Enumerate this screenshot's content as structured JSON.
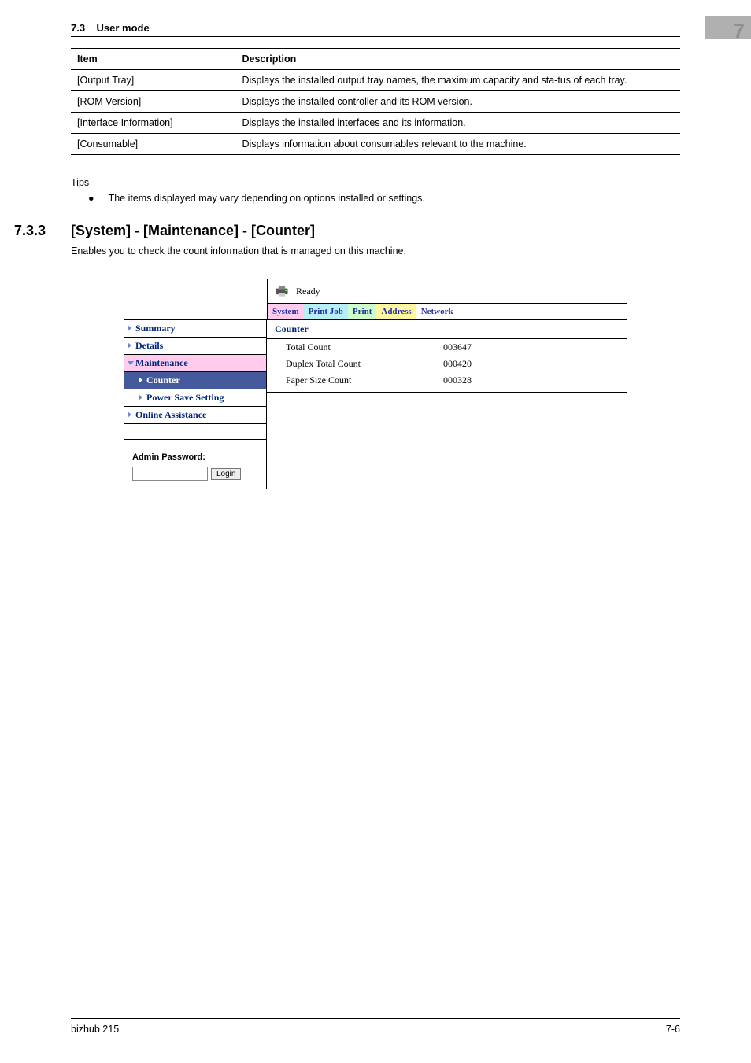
{
  "header": {
    "section": "7.3",
    "title": "User mode",
    "chapter_num": "7"
  },
  "table": {
    "col_item": "Item",
    "col_desc": "Description",
    "rows": [
      {
        "item": "[Output Tray]",
        "desc": "Displays the installed output tray names, the maximum capacity  and sta-tus of each tray."
      },
      {
        "item": "[ROM Version]",
        "desc": "Displays the installed controller and its ROM version."
      },
      {
        "item": "[Interface Information]",
        "desc": "Displays the installed interfaces and its information."
      },
      {
        "item": "[Consumable]",
        "desc": "Displays information about consumables relevant to the machine."
      }
    ]
  },
  "tips": {
    "heading": "Tips",
    "bullet": "The items displayed may vary depending on options installed or settings."
  },
  "section": {
    "num": "7.3.3",
    "title": "[System] - [Maintenance] - [Counter]",
    "body": "Enables you to check the count information that is managed on this machine."
  },
  "webui": {
    "status": "Ready",
    "tabs": {
      "system": "System",
      "printjob": "Print Job",
      "print": "Print",
      "address": "Address",
      "network": "Network"
    },
    "nav": {
      "summary": "Summary",
      "details": "Details",
      "maintenance": "Maintenance",
      "counter": "Counter",
      "power_save": "Power Save Setting",
      "online_assist": "Online Assistance"
    },
    "admin": {
      "label": "Admin Password:",
      "login": "Login"
    },
    "content": {
      "heading": "Counter",
      "rows": [
        {
          "label": "Total Count",
          "value": "003647"
        },
        {
          "label": "Duplex Total Count",
          "value": "000420"
        },
        {
          "label": "Paper Size Count",
          "value": "000328"
        }
      ]
    }
  },
  "footer": {
    "product": "bizhub 215",
    "page": "7-6"
  }
}
